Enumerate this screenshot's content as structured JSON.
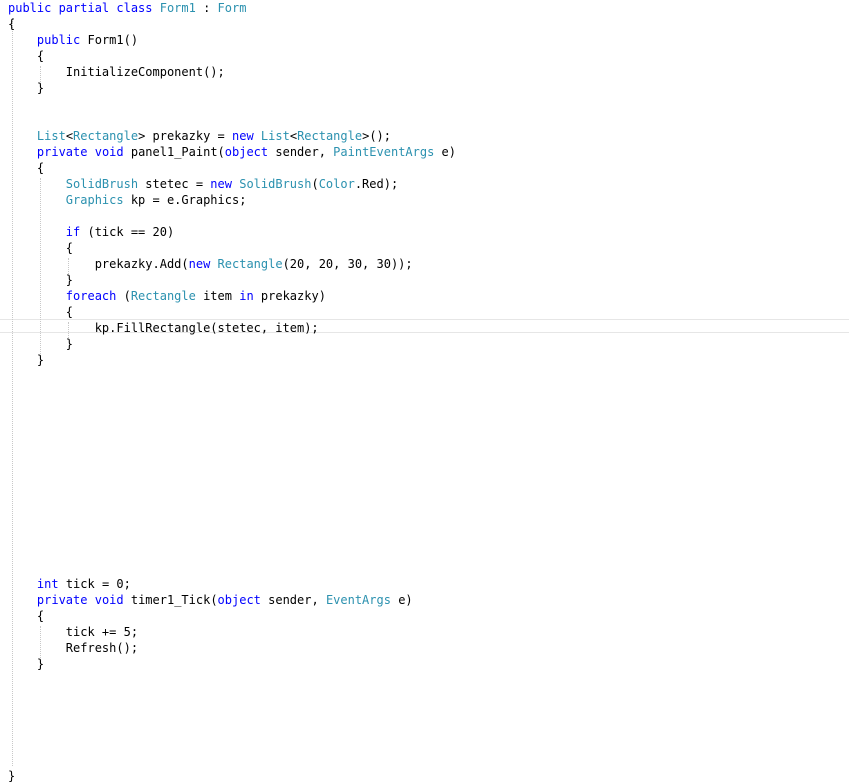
{
  "editor": {
    "language": "C#",
    "colors": {
      "keyword": "#0000ff",
      "type": "#2b91af",
      "text": "#000000",
      "guide": "#c8c8c8",
      "background": "#ffffff"
    },
    "lines": [
      {
        "tokens": [
          {
            "t": "public partial class ",
            "c": "kw"
          },
          {
            "t": "Form1",
            "c": "ty"
          },
          {
            "t": " : "
          },
          {
            "t": "Form",
            "c": "ty"
          }
        ]
      },
      {
        "tokens": [
          {
            "t": "{"
          }
        ]
      },
      {
        "tokens": [
          {
            "t": "    "
          },
          {
            "t": "public",
            "c": "kw"
          },
          {
            "t": " Form1()"
          }
        ]
      },
      {
        "tokens": [
          {
            "t": "    {"
          }
        ]
      },
      {
        "tokens": [
          {
            "t": "        InitializeComponent();"
          }
        ]
      },
      {
        "tokens": [
          {
            "t": "    }"
          }
        ]
      },
      {
        "tokens": []
      },
      {
        "tokens": []
      },
      {
        "tokens": [
          {
            "t": "    "
          },
          {
            "t": "List",
            "c": "ty"
          },
          {
            "t": "<"
          },
          {
            "t": "Rectangle",
            "c": "ty"
          },
          {
            "t": "> prekazky = "
          },
          {
            "t": "new",
            "c": "kw"
          },
          {
            "t": " "
          },
          {
            "t": "List",
            "c": "ty"
          },
          {
            "t": "<"
          },
          {
            "t": "Rectangle",
            "c": "ty"
          },
          {
            "t": ">();"
          }
        ]
      },
      {
        "tokens": [
          {
            "t": "    "
          },
          {
            "t": "private",
            "c": "kw"
          },
          {
            "t": " "
          },
          {
            "t": "void",
            "c": "kw"
          },
          {
            "t": " panel1_Paint("
          },
          {
            "t": "object",
            "c": "kw"
          },
          {
            "t": " sender, "
          },
          {
            "t": "PaintEventArgs",
            "c": "ty"
          },
          {
            "t": " e)"
          }
        ]
      },
      {
        "tokens": [
          {
            "t": "    {"
          }
        ]
      },
      {
        "tokens": [
          {
            "t": "        "
          },
          {
            "t": "SolidBrush",
            "c": "ty"
          },
          {
            "t": " stetec = "
          },
          {
            "t": "new",
            "c": "kw"
          },
          {
            "t": " "
          },
          {
            "t": "SolidBrush",
            "c": "ty"
          },
          {
            "t": "("
          },
          {
            "t": "Color",
            "c": "ty"
          },
          {
            "t": ".Red);"
          }
        ]
      },
      {
        "tokens": [
          {
            "t": "        "
          },
          {
            "t": "Graphics",
            "c": "ty"
          },
          {
            "t": " kp = e.Graphics;"
          }
        ]
      },
      {
        "tokens": []
      },
      {
        "tokens": [
          {
            "t": "        "
          },
          {
            "t": "if",
            "c": "kw"
          },
          {
            "t": " (tick == 20)"
          }
        ]
      },
      {
        "tokens": [
          {
            "t": "        {"
          }
        ]
      },
      {
        "tokens": [
          {
            "t": "            prekazky.Add("
          },
          {
            "t": "new",
            "c": "kw"
          },
          {
            "t": " "
          },
          {
            "t": "Rectangle",
            "c": "ty"
          },
          {
            "t": "(20, 20, 30, 30));"
          }
        ]
      },
      {
        "tokens": [
          {
            "t": "        }"
          }
        ]
      },
      {
        "tokens": [
          {
            "t": "        "
          },
          {
            "t": "foreach",
            "c": "kw"
          },
          {
            "t": " ("
          },
          {
            "t": "Rectangle",
            "c": "ty"
          },
          {
            "t": " item "
          },
          {
            "t": "in",
            "c": "kw"
          },
          {
            "t": " prekazky)"
          }
        ]
      },
      {
        "tokens": [
          {
            "t": "        {"
          }
        ]
      },
      {
        "tokens": [
          {
            "t": "            kp.FillRectangle(stetec, item);"
          }
        ]
      },
      {
        "tokens": [
          {
            "t": "        }"
          }
        ]
      },
      {
        "tokens": [
          {
            "t": "    }"
          }
        ]
      },
      {
        "tokens": []
      },
      {
        "tokens": []
      },
      {
        "tokens": []
      },
      {
        "tokens": []
      },
      {
        "tokens": []
      },
      {
        "tokens": []
      },
      {
        "tokens": []
      },
      {
        "tokens": []
      },
      {
        "tokens": []
      },
      {
        "tokens": []
      },
      {
        "tokens": []
      },
      {
        "tokens": []
      },
      {
        "tokens": []
      },
      {
        "tokens": [
          {
            "t": "    "
          },
          {
            "t": "int",
            "c": "kw"
          },
          {
            "t": " tick = 0;"
          }
        ]
      },
      {
        "tokens": [
          {
            "t": "    "
          },
          {
            "t": "private",
            "c": "kw"
          },
          {
            "t": " "
          },
          {
            "t": "void",
            "c": "kw"
          },
          {
            "t": " timer1_Tick("
          },
          {
            "t": "object",
            "c": "kw"
          },
          {
            "t": " sender, "
          },
          {
            "t": "EventArgs",
            "c": "ty"
          },
          {
            "t": " e)"
          }
        ]
      },
      {
        "tokens": [
          {
            "t": "    {"
          }
        ]
      },
      {
        "tokens": [
          {
            "t": "        tick += 5;"
          }
        ]
      },
      {
        "tokens": [
          {
            "t": "        Refresh();"
          }
        ]
      },
      {
        "tokens": [
          {
            "t": "    }"
          }
        ]
      },
      {
        "tokens": []
      },
      {
        "tokens": []
      },
      {
        "tokens": []
      },
      {
        "tokens": []
      },
      {
        "tokens": []
      },
      {
        "tokens": []
      },
      {
        "tokens": [
          {
            "t": "}"
          }
        ]
      }
    ]
  }
}
